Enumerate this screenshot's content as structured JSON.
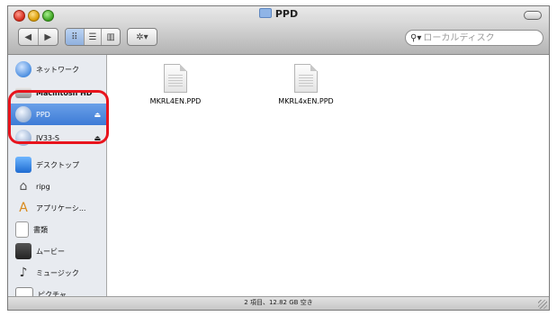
{
  "window": {
    "title": "PPD"
  },
  "toolbar": {
    "back_icon": "chevron-left-icon",
    "forward_icon": "chevron-right-icon",
    "view_icons": [
      "icon-view-icon",
      "list-view-icon",
      "column-view-icon"
    ],
    "action_icon": "gear-icon"
  },
  "search": {
    "placeholder": "ローカルディスク",
    "value": ""
  },
  "sidebar": {
    "items": [
      {
        "label": "ネットワーク",
        "icon": "network-globe-icon",
        "eject": ""
      },
      {
        "label": "Macintosh HD",
        "icon": "hard-drive-icon",
        "eject": ""
      },
      {
        "label": "PPD",
        "icon": "disk-icon",
        "eject": "⏏",
        "selected": true
      },
      {
        "label": "JV33-S",
        "icon": "disk-icon",
        "eject": "⏏"
      },
      {
        "label": "デスクトップ",
        "icon": "desktop-icon",
        "eject": ""
      },
      {
        "label": "ripg",
        "icon": "home-icon",
        "eject": ""
      },
      {
        "label": "アプリケーシ...",
        "icon": "applications-icon",
        "eject": ""
      },
      {
        "label": "書類",
        "icon": "documents-icon",
        "eject": ""
      },
      {
        "label": "ムービー",
        "icon": "movies-icon",
        "eject": ""
      },
      {
        "label": "ミュージック",
        "icon": "music-icon",
        "eject": ""
      },
      {
        "label": "ピクチャ",
        "icon": "pictures-icon",
        "eject": ""
      }
    ]
  },
  "files": [
    {
      "name": "MKRL4EN.PPD",
      "icon": "document-icon"
    },
    {
      "name": "MKRL4xEN.PPD",
      "icon": "document-icon"
    }
  ],
  "status": {
    "text": "2 項目、12.82 GB 空き"
  },
  "colors": {
    "selection": "#3d7bd6",
    "highlight_ring": "#e8141d"
  }
}
